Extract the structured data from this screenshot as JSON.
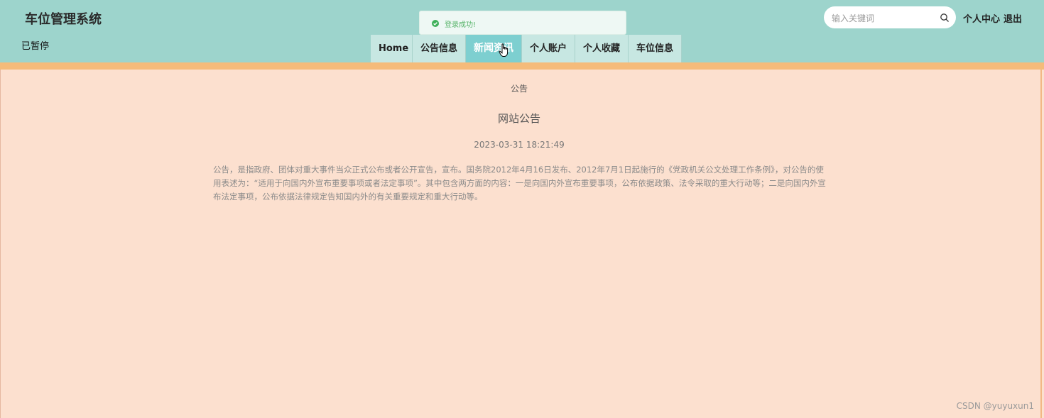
{
  "app": {
    "title": "车位管理系统",
    "paused_label": "已暂停"
  },
  "nav": {
    "items": [
      {
        "label": "Home"
      },
      {
        "label": "公告信息"
      },
      {
        "label": "新闻资讯",
        "active": true
      },
      {
        "label": "个人账户"
      },
      {
        "label": "个人收藏"
      },
      {
        "label": "车位信息"
      }
    ]
  },
  "toast": {
    "message": "登录成功!"
  },
  "search": {
    "placeholder": "输入关键词",
    "value": ""
  },
  "header_links": {
    "profile": "个人中心",
    "logout": "退出"
  },
  "content": {
    "breadcrumb": "公告",
    "title": "网站公告",
    "date": "2023-03-31 18:21:49",
    "body": "公告，是指政府、团体对重大事件当众正式公布或者公开宣告，宣布。国务院2012年4月16日发布、2012年7月1日起施行的《党政机关公文处理工作条例》，对公告的使用表述为：“适用于向国内外宣布重要事项或者法定事项”。其中包含两方面的内容：一是向国内外宣布重要事项，公布依据政策、法令采取的重大行动等；二是向国内外宣布法定事项，公布依据法律规定告知国内外的有关重要规定和重大行动等。"
  },
  "watermark": "CSDN @yuyuxun1",
  "colors": {
    "header_bg": "#9dd4cc",
    "accent_bar": "#f5bb7a",
    "page_bg": "#fce0cf",
    "nav_active": "#7dcfd0",
    "toast_success": "#56b368"
  }
}
